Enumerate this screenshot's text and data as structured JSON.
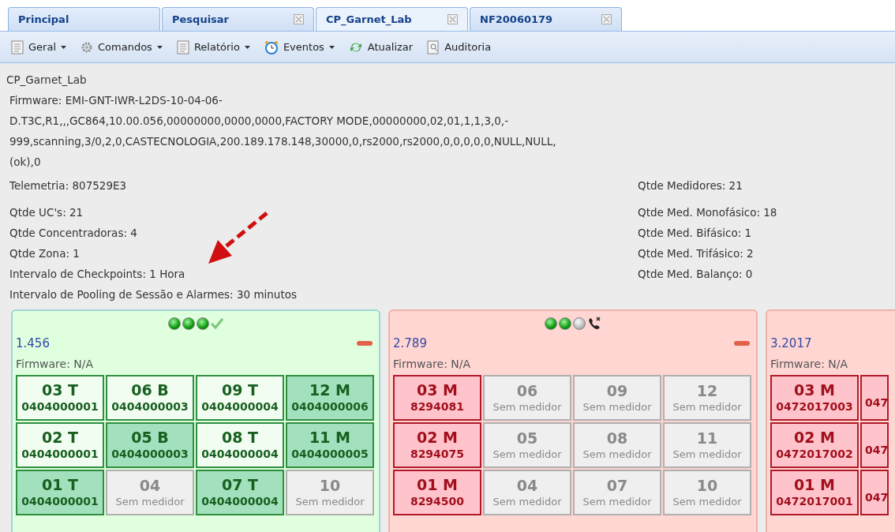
{
  "tabs": [
    {
      "label": "Principal",
      "selected": false,
      "closable": false
    },
    {
      "label": "Pesquisar",
      "selected": false,
      "closable": true
    },
    {
      "label": "CP_Garnet_Lab",
      "selected": true,
      "closable": true
    },
    {
      "label": "NF20060179",
      "selected": false,
      "closable": true
    }
  ],
  "toolbar": [
    {
      "label": "Geral",
      "dropdown": true
    },
    {
      "label": "Comandos",
      "dropdown": true
    },
    {
      "label": "Relatório",
      "dropdown": true
    },
    {
      "label": "Eventos",
      "dropdown": true
    },
    {
      "label": "Atualizar",
      "dropdown": false
    },
    {
      "label": "Auditoria",
      "dropdown": false
    }
  ],
  "info": {
    "title": "CP_Garnet_Lab",
    "firmware_lines": [
      "Firmware: EMI-GNT-IWR-L2DS-10-04-06-",
      "D.T3C,R1,,,GC864,10.00.056,00000000,0000,0000,FACTORY MODE,00000000,02,01,1,1,3,0,-",
      "999,scanning,3/0,2,0,CASTECNOLOGIA,200.189.178.148,30000,0,rs2000,rs2000,0,0,0,0,0,NULL,NULL,",
      "(ok),0"
    ],
    "left": [
      [
        "Telemetria: 807529E3"
      ],
      [
        "Qtde UC's: 21",
        "Qtde Concentradoras: 4",
        "Qtde Zona: 1",
        "Intervalo de Checkpoints: 1 Hora",
        "Intervalo de Pooling de Sessão e Alarmes: 30 minutos"
      ]
    ],
    "right": [
      [
        "Qtde Medidores: 21"
      ],
      [
        "Qtde Med. Monofásico: 18",
        "Qtde Med. Bifásico: 1",
        "Qtde Med. Trifásico: 2",
        "Qtde Med. Balanço: 0"
      ]
    ]
  },
  "cards": [
    {
      "kind": "ok",
      "leds": [
        {
          "on": true
        },
        {
          "on": true
        },
        {
          "on": true
        }
      ],
      "id": "1.456",
      "firmware": "Firmware: N/A",
      "rows": [
        [
          {
            "kind": "light",
            "label": "03 T",
            "serial": "0404000001"
          },
          {
            "kind": "light",
            "label": "06 B",
            "serial": "0404000003"
          },
          {
            "kind": "light",
            "label": "09 T",
            "serial": "0404000004"
          },
          {
            "kind": "dark",
            "label": "12 M",
            "serial": "0404000006"
          }
        ],
        [
          {
            "kind": "light",
            "label": "02 T",
            "serial": "0404000001"
          },
          {
            "kind": "dark",
            "label": "05 B",
            "serial": "0404000003"
          },
          {
            "kind": "light",
            "label": "08 T",
            "serial": "0404000004"
          },
          {
            "kind": "dark",
            "label": "11 M",
            "serial": "0404000005"
          }
        ],
        [
          {
            "kind": "dark",
            "label": "01 T",
            "serial": "0404000001"
          },
          {
            "kind": "empty",
            "label": "04",
            "serial": "Sem medidor"
          },
          {
            "kind": "dark",
            "label": "07 T",
            "serial": "0404000004"
          },
          {
            "kind": "empty",
            "label": "10",
            "serial": "Sem medidor"
          }
        ]
      ]
    },
    {
      "kind": "fault",
      "leds": [
        {
          "on": true
        },
        {
          "on": true
        },
        {
          "on": false
        }
      ],
      "id": "2.789",
      "firmware": "Firmware: N/A",
      "rows": [
        [
          {
            "kind": "fault",
            "label": "03 M",
            "serial": "8294081"
          },
          {
            "kind": "empty",
            "label": "06",
            "serial": "Sem medidor"
          },
          {
            "kind": "empty",
            "label": "09",
            "serial": "Sem medidor"
          },
          {
            "kind": "empty",
            "label": "12",
            "serial": "Sem medidor"
          }
        ],
        [
          {
            "kind": "fault",
            "label": "02 M",
            "serial": "8294075"
          },
          {
            "kind": "empty",
            "label": "05",
            "serial": "Sem medidor"
          },
          {
            "kind": "empty",
            "label": "08",
            "serial": "Sem medidor"
          },
          {
            "kind": "empty",
            "label": "11",
            "serial": "Sem medidor"
          }
        ],
        [
          {
            "kind": "fault",
            "label": "01 M",
            "serial": "8294500"
          },
          {
            "kind": "empty",
            "label": "04",
            "serial": "Sem medidor"
          },
          {
            "kind": "empty",
            "label": "07",
            "serial": "Sem medidor"
          },
          {
            "kind": "empty",
            "label": "10",
            "serial": "Sem medidor"
          }
        ]
      ]
    },
    {
      "kind": "fault",
      "id": "3.2017",
      "firmware": "Firmware: N/A",
      "rows": [
        [
          {
            "kind": "fault",
            "label": "03 M",
            "serial": "0472017003"
          },
          {
            "kind": "fault-cut",
            "serial": "047"
          }
        ],
        [
          {
            "kind": "fault",
            "label": "02 M",
            "serial": "0472017002"
          },
          {
            "kind": "fault-cut",
            "serial": "047"
          }
        ],
        [
          {
            "kind": "fault",
            "label": "01 M",
            "serial": "0472017001"
          },
          {
            "kind": "fault-cut",
            "serial": "047"
          }
        ]
      ]
    }
  ]
}
